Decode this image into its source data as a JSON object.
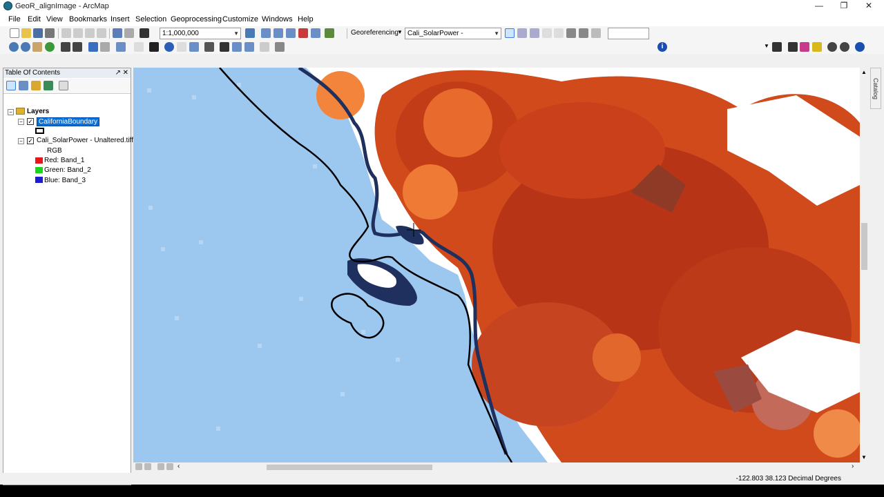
{
  "window": {
    "title": "GeoR_alignImage - ArcMap",
    "minimize": "—",
    "maximize": "❐",
    "close": "✕"
  },
  "menu": [
    "File",
    "Edit",
    "View",
    "Bookmarks",
    "Insert",
    "Selection",
    "Geoprocessing",
    "Customize",
    "Windows",
    "Help"
  ],
  "toolbar": {
    "scale_value": "1:1,000,000",
    "georef_label": "Georeferencing",
    "georef_layer": "Cali_SolarPower - Unaltered.tiff",
    "info_icon": "i"
  },
  "toc": {
    "title": "Table Of Contents",
    "pin": "↗",
    "close": "✕",
    "root": "Layers",
    "layer1": {
      "name": "CaliforniaBoundary",
      "checked": true
    },
    "layer2": {
      "name": "Cali_SolarPower - Unaltered.tiff",
      "checked": true,
      "mode": "RGB"
    },
    "bands": [
      {
        "label": "Red:   Band_1",
        "color": "#e8161b"
      },
      {
        "label": "Green: Band_2",
        "color": "#1ad61a"
      },
      {
        "label": "Blue:   Band_3",
        "color": "#1c1ccf"
      }
    ]
  },
  "catalog_tab": "Catalog",
  "status": {
    "coords": "-122.803  38.123 Decimal Degrees"
  },
  "colors": {
    "water": "#9cc7ef",
    "raster_dark": "#b73416",
    "raster_mid": "#d04a1c",
    "raster_light": "#ef7a35",
    "coast": "#1f2f5e",
    "selection": "#0b6fd3"
  }
}
